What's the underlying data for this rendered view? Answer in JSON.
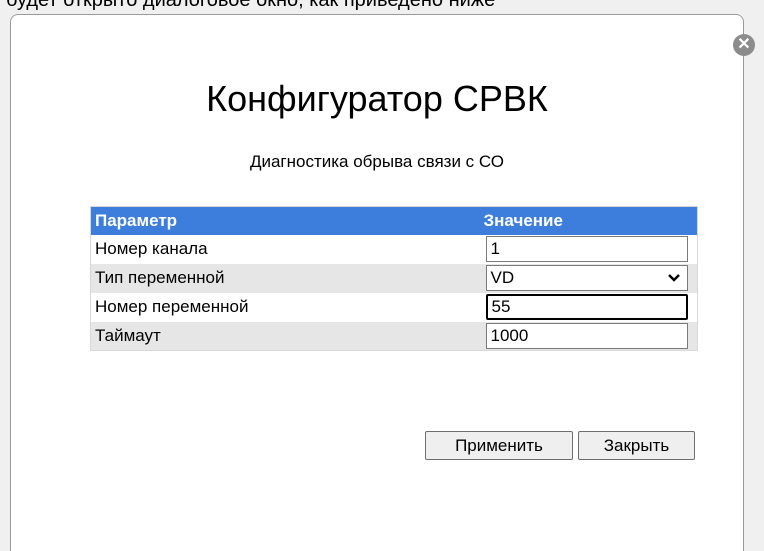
{
  "page_strip_text": "будет открыто диалоговое окно, как приведено ниже",
  "dialog": {
    "title": "Конфигуратор СРВК",
    "subtitle": "Диагностика обрыва связи с СО",
    "close_icon": "x-circle-icon"
  },
  "table": {
    "headers": {
      "param": "Параметр",
      "value": "Значение"
    },
    "rows": [
      {
        "label": "Номер канала",
        "value": "1",
        "kind": "input"
      },
      {
        "label": "Тип переменной",
        "value": "VD",
        "kind": "select"
      },
      {
        "label": "Номер переменной",
        "value": "55",
        "kind": "input",
        "focused": true
      },
      {
        "label": "Таймаут",
        "value": "1000",
        "kind": "input"
      }
    ]
  },
  "buttons": {
    "apply": "Применить",
    "close": "Закрыть"
  },
  "colors": {
    "header_bg": "#3d7ddc",
    "header_text": "#ffffff",
    "alt_row_bg": "#e6e6e6"
  }
}
